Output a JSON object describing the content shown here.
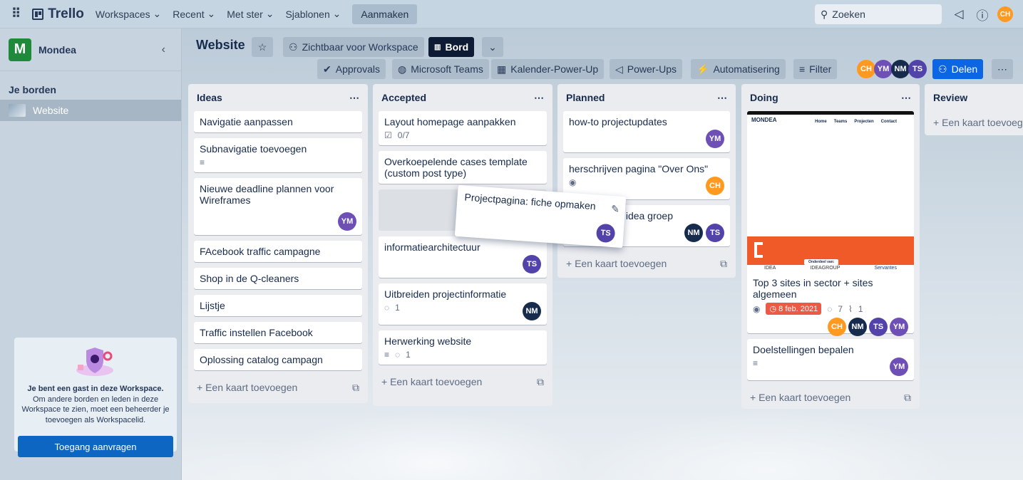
{
  "topbar": {
    "logo": "Trello",
    "workspaces": "Workspaces",
    "recent": "Recent",
    "starred": "Met ster",
    "templates": "Sjablonen",
    "create": "Aanmaken",
    "search_placeholder": "Zoeken",
    "user_initials": "CH"
  },
  "sidebar": {
    "workspace_letter": "M",
    "workspace_name": "Mondea",
    "section": "Je borden",
    "board": "Website",
    "guest_title": "Je bent een gast in deze Workspace.",
    "guest_text": "Om andere borden en leden in deze Workspace te zien, moet een beheerder je toevoegen als Workspacelid.",
    "guest_button": "Toegang aanvragen"
  },
  "board": {
    "title": "Website",
    "visibility": "Zichtbaar voor Workspace",
    "view": "Bord",
    "approvals": "Approvals",
    "teams": "Microsoft Teams",
    "calendar": "Kalender-Power-Up",
    "powerups": "Power-Ups",
    "automation": "Automatisering",
    "filter": "Filter",
    "share": "Delen",
    "members": [
      "CH",
      "YM",
      "NM",
      "TS"
    ]
  },
  "lists": [
    {
      "title": "Ideas",
      "cards": [
        "Navigatie aanpassen",
        "Subnavigatie toevoegen",
        "Nieuwe deadline plannen voor Wireframes",
        "FAcebook traffic campagne",
        "Shop in de Q-cleaners",
        "Lijstje",
        "Traffic instellen Facebook",
        "Oplossing catalog campagn"
      ]
    },
    {
      "title": "Accepted",
      "cards": [
        "Layout homepage aanpakken",
        "Overkoepelende cases template (custom post type)",
        "informatiearchitectuur",
        "Uitbreiden projectinformatie",
        "Herwerking website"
      ],
      "checklist": "0/7",
      "comments_1": "1",
      "comments_2": "1"
    },
    {
      "title": "Planned",
      "cards": [
        "how-to projectupdates",
        "herschrijven pagina \"Over Ons\"",
        "gina idea groep"
      ]
    },
    {
      "title": "Doing",
      "cards": [
        "Top 3 sites in sector + sites algemeen",
        "Doelstellingen bepalen"
      ],
      "due": "8 feb. 2021",
      "comments": "7",
      "attachments": "1",
      "cover": {
        "brand": "MONDEA",
        "nav": [
          "Home",
          "Teams",
          "Projecten",
          "Contact"
        ],
        "part_of": "Onderdeel van:",
        "group": "IDEAGROUP",
        "idea": "IDEA",
        "servantes": "Servantes"
      }
    },
    {
      "title": "Review",
      "cards": []
    }
  ],
  "add_card": "Een kaart toevoegen",
  "dragging_card": "Projectpagina: fiche opmaken",
  "colors": {
    "create_bg": "#a9bccd",
    "share": "#0c66e4",
    "due": "#eb5a46",
    "cover_orange": "#f05a28"
  }
}
